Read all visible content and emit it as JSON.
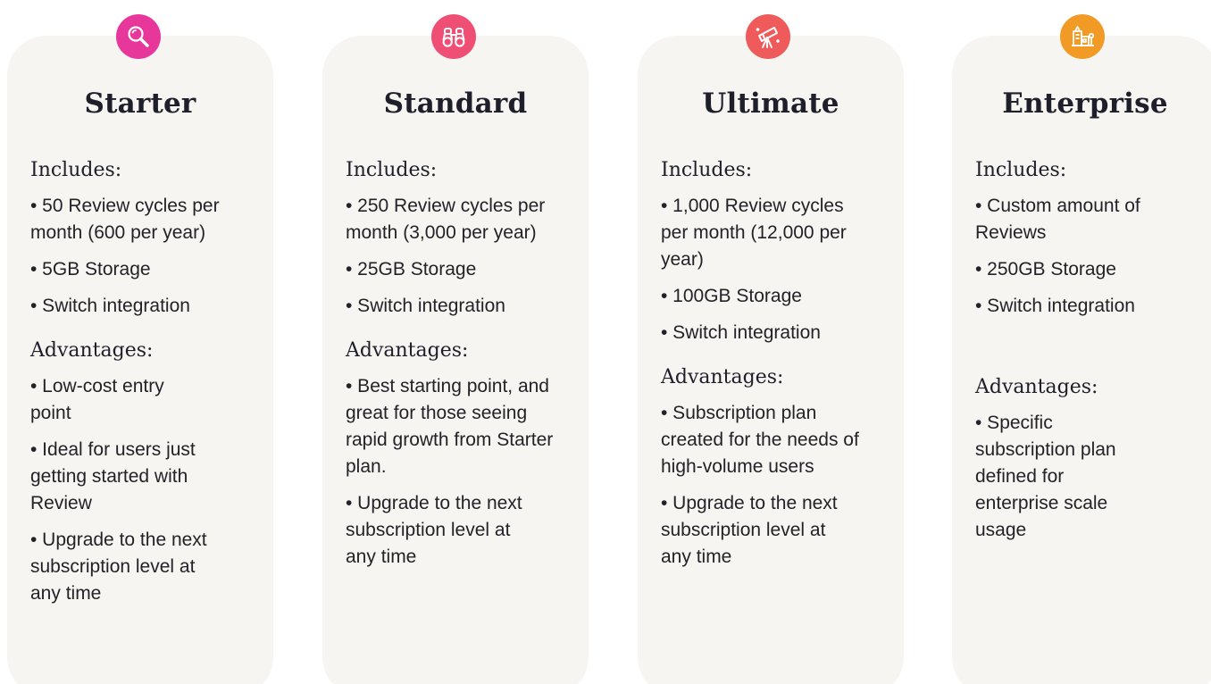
{
  "colors": {
    "card_bg": "#f6f5f1",
    "starter_icon": "#e8379b",
    "standard_icon": "#ef4f75",
    "ultimate_icon": "#ef5a5a",
    "enterprise_icon": "#f29a26"
  },
  "plans": [
    {
      "name": "Starter",
      "icon": "magnifier-icon",
      "includes_label": "Includes:",
      "includes": [
        "• 50 Review cycles per month (600 per year)",
        "• 5GB Storage",
        "• Switch integration"
      ],
      "advantages_label": "Advantages:",
      "advantages": [
        "• Low-cost entry point",
        "• Ideal for users just getting started with Review",
        "• Upgrade to the next subscription level at any time"
      ]
    },
    {
      "name": "Standard",
      "icon": "binoculars-icon",
      "includes_label": "Includes:",
      "includes": [
        "• 250 Review cycles per month (3,000 per year)",
        "• 25GB Storage",
        "• Switch integration"
      ],
      "advantages_label": "Advantages:",
      "advantages": [
        "• Best starting point, and great for those seeing rapid growth from Starter plan.",
        "• Upgrade to the next subscription level at any time"
      ]
    },
    {
      "name": "Ultimate",
      "icon": "telescope-icon",
      "includes_label": "Includes:",
      "includes": [
        "• 1,000 Review cycles per month (12,000 per year)",
        "• 100GB Storage",
        "• Switch integration"
      ],
      "advantages_label": "Advantages:",
      "advantages": [
        "• Subscription plan created for the needs of  high-volume users",
        "• Upgrade to the next subscription level at any time"
      ]
    },
    {
      "name": "Enterprise",
      "icon": "buildings-icon",
      "includes_label": "Includes:",
      "includes": [
        "• Custom amount of Reviews",
        "• 250GB Storage",
        "• Switch integration"
      ],
      "advantages_label": "Advantages:",
      "advantages": [
        "• Specific subscription plan defined for enterprise scale usage"
      ]
    }
  ]
}
